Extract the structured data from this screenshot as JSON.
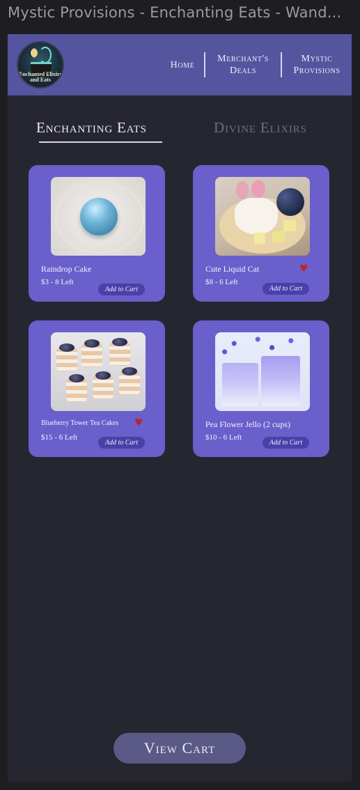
{
  "window": {
    "title": "Mystic Provisions - Enchanting Eats - Wand..."
  },
  "header": {
    "logo_text": "Enchanted Elixirs and Eats",
    "nav": {
      "home": "Home",
      "deals_line1": "Merchant's",
      "deals_line2": "Deals",
      "mystic_line1": "Mystic",
      "mystic_line2": "Provisions"
    }
  },
  "tabs": {
    "active": "Enchanting Eats",
    "inactive": "Divine Elixirs"
  },
  "products": [
    {
      "name": "Raindrop Cake",
      "price": "$3   -  8 Left",
      "cart_label": "Add to Cart",
      "image_icon": "raindrop-cake-image",
      "favorite": false
    },
    {
      "name": "Cute Liquid Cat",
      "price": "$8   -  6 Left",
      "cart_label": "Add to Cart",
      "image_icon": "cat-cake-image",
      "favorite": true,
      "heart": "♥"
    },
    {
      "name": "Blueberry Tower Tea Cakes",
      "price": "$15   -  6 Left",
      "cart_label": "Add to Cart",
      "image_icon": "blueberry-cakes-image",
      "favorite": true,
      "heart": "♥"
    },
    {
      "name": "Pea Flower Jello (2 cups)",
      "price": "$10  -  6 Left",
      "cart_label": "Add to Cart",
      "image_icon": "pea-flower-jello-image",
      "favorite": false
    }
  ],
  "footer": {
    "view_cart": "View Cart"
  },
  "colors": {
    "header_bg": "#55549f",
    "card_bg": "#6a5fcb",
    "page_bg": "#262631",
    "button_bg": "#4a40a8",
    "heart": "#b8262e",
    "view_cart_bg": "#5b5a86"
  }
}
